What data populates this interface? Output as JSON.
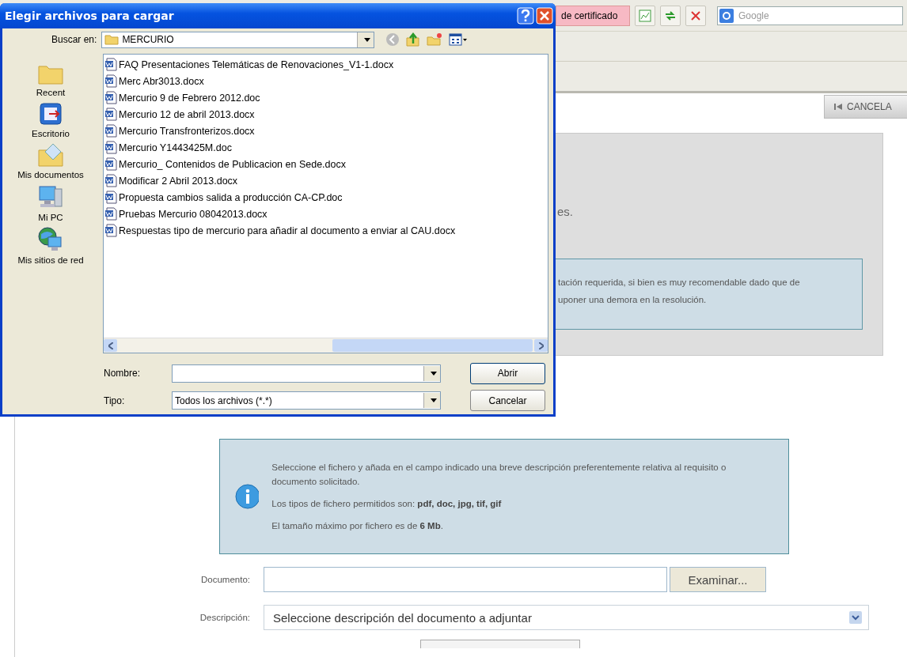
{
  "browser_toolbar": {
    "certificate_field": "de certificado",
    "search": {
      "placeholder": "Google"
    }
  },
  "page": {
    "cancel_button": "CANCELA",
    "panel_text": "es.",
    "notice_lines": [
      "tación requerida, si bien es muy recomendable dado que de",
      "uponer una demora en la resolución."
    ],
    "info_lines": [
      "Seleccione el fichero y añada en el campo indicado una breve descripción preferentemente relativa al requisito o documento solicitado.",
      "Los tipos de fichero permitidos son: **pdf, doc, jpg, tif, gif**",
      "El tamaño máximo por fichero es de **6 Mb**."
    ],
    "form": {
      "document_label": "Documento:",
      "browse_button": "Examinar...",
      "description_label": "Descripción:",
      "description_select": "Seleccione descripción del documento a adjuntar"
    }
  },
  "dialog": {
    "title": "Elegir archivos para cargar",
    "look_in_label": "Buscar en:",
    "look_in_value": "MERCURIO",
    "places": [
      {
        "label": "Recent",
        "kind": "recent"
      },
      {
        "label": "Escritorio",
        "kind": "desktop"
      },
      {
        "label": "Mis documentos",
        "kind": "documents"
      },
      {
        "label": "Mi PC",
        "kind": "computer"
      },
      {
        "label": "Mis sitios de red",
        "kind": "network"
      }
    ],
    "files": [
      "FAQ Presentaciones Telemáticas de Renovaciones_V1-1.docx",
      "Merc Abr3013.docx",
      "Mercurio 9 de Febrero 2012.doc",
      "Mercurio 12 de abril 2013.docx",
      "Mercurio Transfronterizos.docx",
      "Mercurio Y1443425M.doc",
      "Mercurio_ Contenidos de Publicacion en Sede.docx",
      "Modificar 2 Abril 2013.docx",
      "Propuesta cambios salida a producción CA-CP.doc",
      "Pruebas Mercurio 08042013.docx",
      "Respuestas tipo de mercurio para añadir al documento a enviar al CAU.docx"
    ],
    "file_name_label": "Nombre:",
    "file_type_label": "Tipo:",
    "file_type_value": "Todos los archivos (*.*)",
    "buttons": [
      "Abrir",
      "Cancelar"
    ]
  }
}
